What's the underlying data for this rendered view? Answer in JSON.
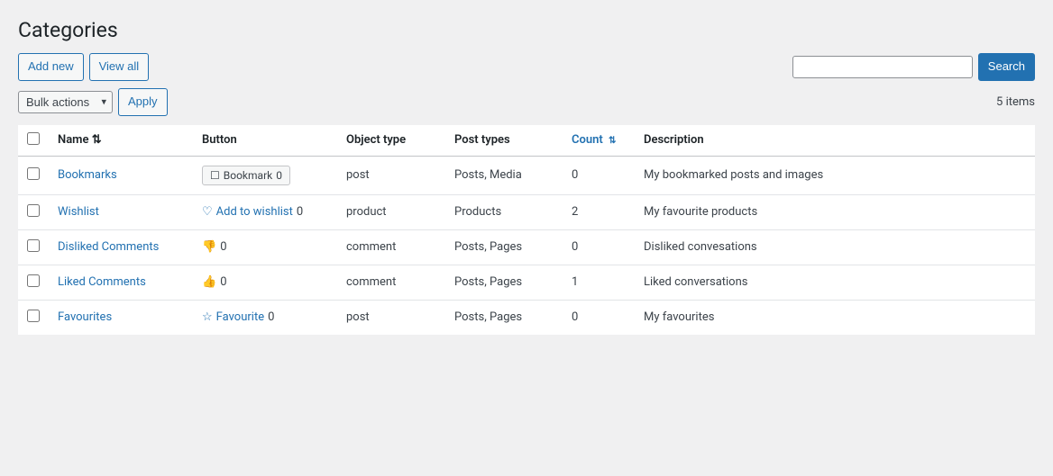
{
  "page": {
    "title": "Categories",
    "items_count": "5 items"
  },
  "toolbar": {
    "add_new_label": "Add new",
    "view_all_label": "View all",
    "search_label": "Search",
    "search_placeholder": "",
    "bulk_actions_label": "Bulk actions",
    "apply_label": "Apply"
  },
  "table": {
    "columns": [
      {
        "key": "cb",
        "label": ""
      },
      {
        "key": "name",
        "label": "Name",
        "sortable": true
      },
      {
        "key": "button",
        "label": "Button",
        "sortable": false
      },
      {
        "key": "object_type",
        "label": "Object type",
        "sortable": false
      },
      {
        "key": "post_types",
        "label": "Post types",
        "sortable": false
      },
      {
        "key": "count",
        "label": "Count",
        "sortable": true
      },
      {
        "key": "description",
        "label": "Description",
        "sortable": false
      }
    ],
    "rows": [
      {
        "id": 1,
        "name": "Bookmarks",
        "button_icon": "☐",
        "button_text": "Bookmark",
        "button_count": "0",
        "button_style": "border",
        "object_type": "post",
        "post_types": "Posts, Media",
        "count": "0",
        "description": "My bookmarked posts and images"
      },
      {
        "id": 2,
        "name": "Wishlist",
        "button_icon": "♡",
        "button_text": "Add to wishlist",
        "button_count": "0",
        "button_style": "inline",
        "object_type": "product",
        "post_types": "Products",
        "count": "2",
        "description": "My favourite products"
      },
      {
        "id": 3,
        "name": "Disliked Comments",
        "button_icon": "👎",
        "button_text": "",
        "button_count": "0",
        "button_style": "icon-only",
        "object_type": "comment",
        "post_types": "Posts, Pages",
        "count": "0",
        "description": "Disliked convesations"
      },
      {
        "id": 4,
        "name": "Liked Comments",
        "button_icon": "👍",
        "button_text": "",
        "button_count": "0",
        "button_style": "icon-only",
        "object_type": "comment",
        "post_types": "Posts, Pages",
        "count": "1",
        "description": "Liked conversations"
      },
      {
        "id": 5,
        "name": "Favourites",
        "button_icon": "☆",
        "button_text": "Favourite",
        "button_count": "0",
        "button_style": "inline",
        "object_type": "post",
        "post_types": "Posts, Pages",
        "count": "0",
        "description": "My favourites"
      }
    ]
  }
}
